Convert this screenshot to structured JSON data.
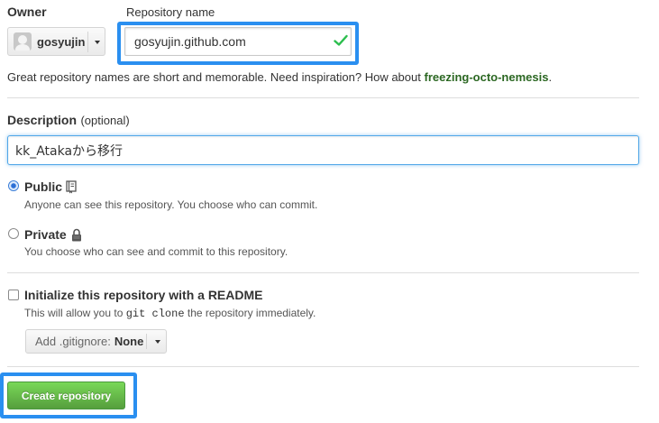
{
  "owner": {
    "label": "Owner",
    "name": "gosyujin",
    "avatar_icon": "user-avatar-icon"
  },
  "repository_name": {
    "label": "Repository name",
    "value": "gosyujin.github.com",
    "valid_icon": "check-icon",
    "valid_color": "#2cbe4e"
  },
  "hint": {
    "text": "Great repository names are short and memorable. Need inspiration? How about",
    "suggestion": "freezing-octo-nemesis",
    "period": "."
  },
  "description": {
    "label": "Description",
    "optional": "(optional)",
    "value": "kk_Atakaから移行"
  },
  "visibility": {
    "public": {
      "title": "Public",
      "icon": "repo-book-icon",
      "description": "Anyone can see this repository. You choose who can commit.",
      "selected": true
    },
    "private": {
      "title": "Private",
      "icon": "lock-icon",
      "description": "You choose who can see and commit to this repository.",
      "selected": false
    }
  },
  "readme": {
    "title": "Initialize this repository with a README",
    "desc_before": "This will allow you to",
    "desc_code": "git clone",
    "desc_after": "the repository immediately.",
    "checked": false
  },
  "gitignore": {
    "prefix": "Add .gitignore:",
    "value": "None"
  },
  "create_button": {
    "label": "Create repository",
    "color": "#6cc644"
  },
  "highlight_color": "#2a8ff0"
}
